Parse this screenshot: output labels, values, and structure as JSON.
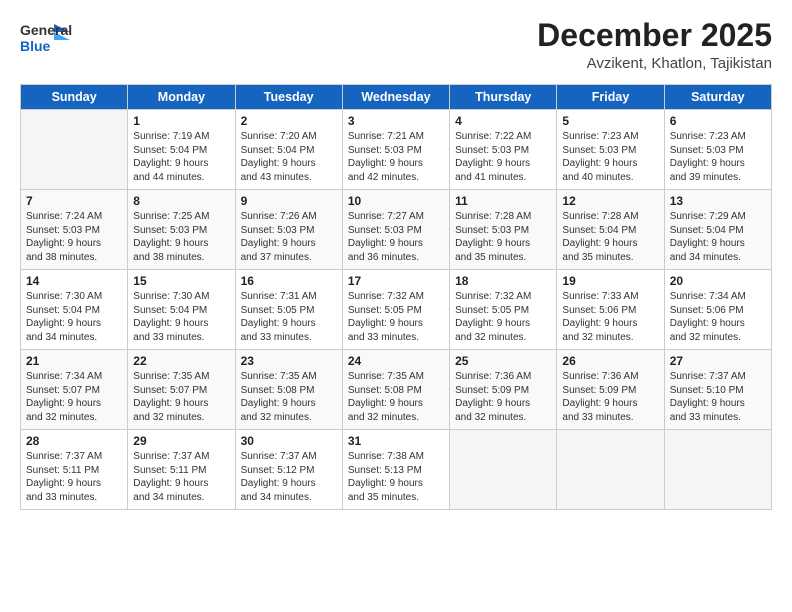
{
  "header": {
    "logo_general": "General",
    "logo_blue": "Blue",
    "month_title": "December 2025",
    "subtitle": "Avzikent, Khatlon, Tajikistan"
  },
  "weekdays": [
    "Sunday",
    "Monday",
    "Tuesday",
    "Wednesday",
    "Thursday",
    "Friday",
    "Saturday"
  ],
  "weeks": [
    [
      {
        "day": "",
        "info": ""
      },
      {
        "day": "1",
        "info": "Sunrise: 7:19 AM\nSunset: 5:04 PM\nDaylight: 9 hours\nand 44 minutes."
      },
      {
        "day": "2",
        "info": "Sunrise: 7:20 AM\nSunset: 5:04 PM\nDaylight: 9 hours\nand 43 minutes."
      },
      {
        "day": "3",
        "info": "Sunrise: 7:21 AM\nSunset: 5:03 PM\nDaylight: 9 hours\nand 42 minutes."
      },
      {
        "day": "4",
        "info": "Sunrise: 7:22 AM\nSunset: 5:03 PM\nDaylight: 9 hours\nand 41 minutes."
      },
      {
        "day": "5",
        "info": "Sunrise: 7:23 AM\nSunset: 5:03 PM\nDaylight: 9 hours\nand 40 minutes."
      },
      {
        "day": "6",
        "info": "Sunrise: 7:23 AM\nSunset: 5:03 PM\nDaylight: 9 hours\nand 39 minutes."
      }
    ],
    [
      {
        "day": "7",
        "info": "Sunrise: 7:24 AM\nSunset: 5:03 PM\nDaylight: 9 hours\nand 38 minutes."
      },
      {
        "day": "8",
        "info": "Sunrise: 7:25 AM\nSunset: 5:03 PM\nDaylight: 9 hours\nand 38 minutes."
      },
      {
        "day": "9",
        "info": "Sunrise: 7:26 AM\nSunset: 5:03 PM\nDaylight: 9 hours\nand 37 minutes."
      },
      {
        "day": "10",
        "info": "Sunrise: 7:27 AM\nSunset: 5:03 PM\nDaylight: 9 hours\nand 36 minutes."
      },
      {
        "day": "11",
        "info": "Sunrise: 7:28 AM\nSunset: 5:03 PM\nDaylight: 9 hours\nand 35 minutes."
      },
      {
        "day": "12",
        "info": "Sunrise: 7:28 AM\nSunset: 5:04 PM\nDaylight: 9 hours\nand 35 minutes."
      },
      {
        "day": "13",
        "info": "Sunrise: 7:29 AM\nSunset: 5:04 PM\nDaylight: 9 hours\nand 34 minutes."
      }
    ],
    [
      {
        "day": "14",
        "info": "Sunrise: 7:30 AM\nSunset: 5:04 PM\nDaylight: 9 hours\nand 34 minutes."
      },
      {
        "day": "15",
        "info": "Sunrise: 7:30 AM\nSunset: 5:04 PM\nDaylight: 9 hours\nand 33 minutes."
      },
      {
        "day": "16",
        "info": "Sunrise: 7:31 AM\nSunset: 5:05 PM\nDaylight: 9 hours\nand 33 minutes."
      },
      {
        "day": "17",
        "info": "Sunrise: 7:32 AM\nSunset: 5:05 PM\nDaylight: 9 hours\nand 33 minutes."
      },
      {
        "day": "18",
        "info": "Sunrise: 7:32 AM\nSunset: 5:05 PM\nDaylight: 9 hours\nand 32 minutes."
      },
      {
        "day": "19",
        "info": "Sunrise: 7:33 AM\nSunset: 5:06 PM\nDaylight: 9 hours\nand 32 minutes."
      },
      {
        "day": "20",
        "info": "Sunrise: 7:34 AM\nSunset: 5:06 PM\nDaylight: 9 hours\nand 32 minutes."
      }
    ],
    [
      {
        "day": "21",
        "info": "Sunrise: 7:34 AM\nSunset: 5:07 PM\nDaylight: 9 hours\nand 32 minutes."
      },
      {
        "day": "22",
        "info": "Sunrise: 7:35 AM\nSunset: 5:07 PM\nDaylight: 9 hours\nand 32 minutes."
      },
      {
        "day": "23",
        "info": "Sunrise: 7:35 AM\nSunset: 5:08 PM\nDaylight: 9 hours\nand 32 minutes."
      },
      {
        "day": "24",
        "info": "Sunrise: 7:35 AM\nSunset: 5:08 PM\nDaylight: 9 hours\nand 32 minutes."
      },
      {
        "day": "25",
        "info": "Sunrise: 7:36 AM\nSunset: 5:09 PM\nDaylight: 9 hours\nand 32 minutes."
      },
      {
        "day": "26",
        "info": "Sunrise: 7:36 AM\nSunset: 5:09 PM\nDaylight: 9 hours\nand 33 minutes."
      },
      {
        "day": "27",
        "info": "Sunrise: 7:37 AM\nSunset: 5:10 PM\nDaylight: 9 hours\nand 33 minutes."
      }
    ],
    [
      {
        "day": "28",
        "info": "Sunrise: 7:37 AM\nSunset: 5:11 PM\nDaylight: 9 hours\nand 33 minutes."
      },
      {
        "day": "29",
        "info": "Sunrise: 7:37 AM\nSunset: 5:11 PM\nDaylight: 9 hours\nand 34 minutes."
      },
      {
        "day": "30",
        "info": "Sunrise: 7:37 AM\nSunset: 5:12 PM\nDaylight: 9 hours\nand 34 minutes."
      },
      {
        "day": "31",
        "info": "Sunrise: 7:38 AM\nSunset: 5:13 PM\nDaylight: 9 hours\nand 35 minutes."
      },
      {
        "day": "",
        "info": ""
      },
      {
        "day": "",
        "info": ""
      },
      {
        "day": "",
        "info": ""
      }
    ]
  ]
}
